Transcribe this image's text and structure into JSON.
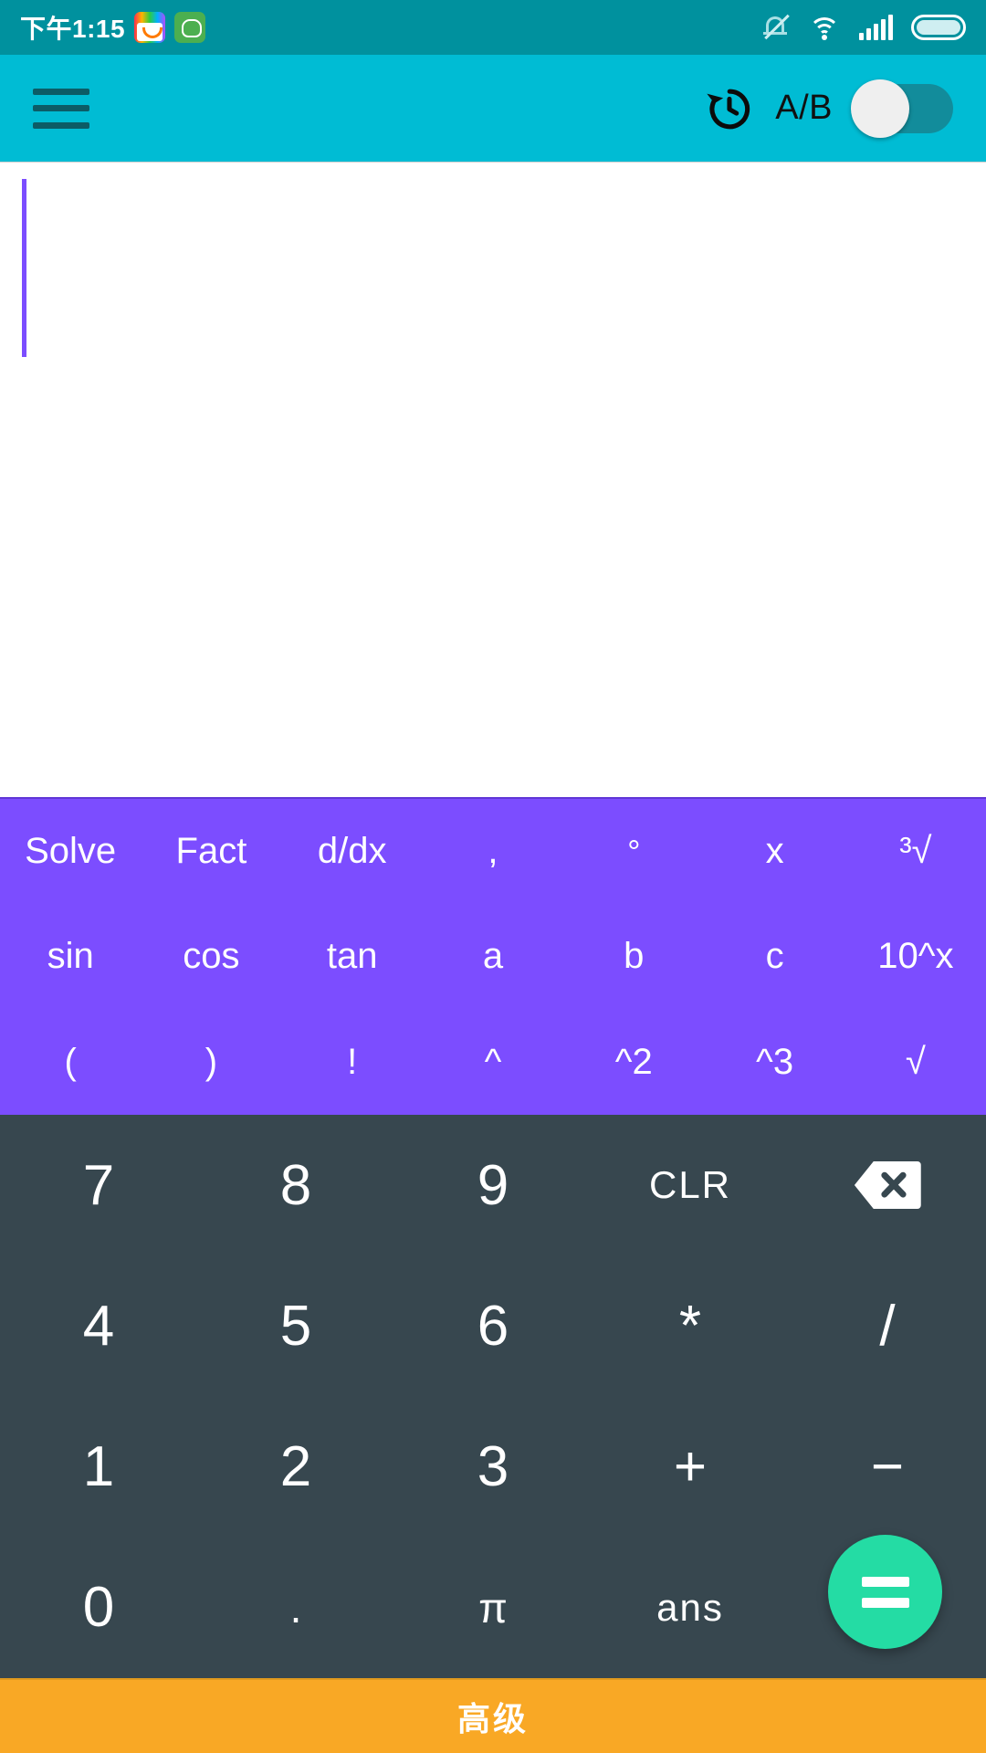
{
  "statusbar": {
    "time": "下午1:15",
    "notification_icons": [
      "photo-app-icon",
      "green-app-icon"
    ],
    "system_icons": [
      "mute-icon",
      "wifi-icon",
      "signal-icon",
      "battery-icon"
    ]
  },
  "toolbar": {
    "menu_icon": "hamburger-menu-icon",
    "history_icon": "history-icon",
    "ab_label": "A/B",
    "toggle_state": "off"
  },
  "display": {
    "expression": "",
    "cursor_visible": true
  },
  "funcpad": {
    "rows": [
      [
        {
          "label": "Solve",
          "name": "solve"
        },
        {
          "label": "Fact",
          "name": "fact"
        },
        {
          "label": "d/dx",
          "name": "ddx"
        },
        {
          "label": ",",
          "name": "comma"
        },
        {
          "label": "°",
          "name": "degree"
        },
        {
          "label": "x",
          "name": "x"
        },
        {
          "label": "³√",
          "name": "cube-root"
        }
      ],
      [
        {
          "label": "sin",
          "name": "sin"
        },
        {
          "label": "cos",
          "name": "cos"
        },
        {
          "label": "tan",
          "name": "tan"
        },
        {
          "label": "a",
          "name": "a"
        },
        {
          "label": "b",
          "name": "b"
        },
        {
          "label": "c",
          "name": "c"
        },
        {
          "label": "10^x",
          "name": "ten-pow-x"
        }
      ],
      [
        {
          "label": "(",
          "name": "open-paren"
        },
        {
          "label": ")",
          "name": "close-paren"
        },
        {
          "label": "!",
          "name": "factorial"
        },
        {
          "label": "^",
          "name": "power"
        },
        {
          "label": "^2",
          "name": "square"
        },
        {
          "label": "^3",
          "name": "cube"
        },
        {
          "label": "√",
          "name": "sqrt"
        }
      ]
    ]
  },
  "numpad": {
    "rows": [
      [
        {
          "label": "7",
          "name": "7"
        },
        {
          "label": "8",
          "name": "8"
        },
        {
          "label": "9",
          "name": "9"
        },
        {
          "label": "CLR",
          "name": "clear"
        },
        {
          "label": "",
          "name": "backspace"
        }
      ],
      [
        {
          "label": "4",
          "name": "4"
        },
        {
          "label": "5",
          "name": "5"
        },
        {
          "label": "6",
          "name": "6"
        },
        {
          "label": "*",
          "name": "multiply"
        },
        {
          "label": "/",
          "name": "divide"
        }
      ],
      [
        {
          "label": "1",
          "name": "1"
        },
        {
          "label": "2",
          "name": "2"
        },
        {
          "label": "3",
          "name": "3"
        },
        {
          "label": "+",
          "name": "plus"
        },
        {
          "label": "−",
          "name": "minus"
        }
      ],
      [
        {
          "label": "0",
          "name": "0"
        },
        {
          "label": ".",
          "name": "decimal"
        },
        {
          "label": "π",
          "name": "pi"
        },
        {
          "label": "ans",
          "name": "ans"
        },
        {
          "label": "",
          "name": "equals-slot"
        }
      ]
    ],
    "equals_label": "="
  },
  "bottombar": {
    "label": "高级"
  },
  "colors": {
    "statusbar": "#00919E",
    "toolbar": "#00BCD4",
    "funcpad": "#7C4DFF",
    "numpad": "#37474F",
    "equals": "#24DCA4",
    "bottombar": "#F9A825",
    "cursor": "#7C4DFF"
  }
}
